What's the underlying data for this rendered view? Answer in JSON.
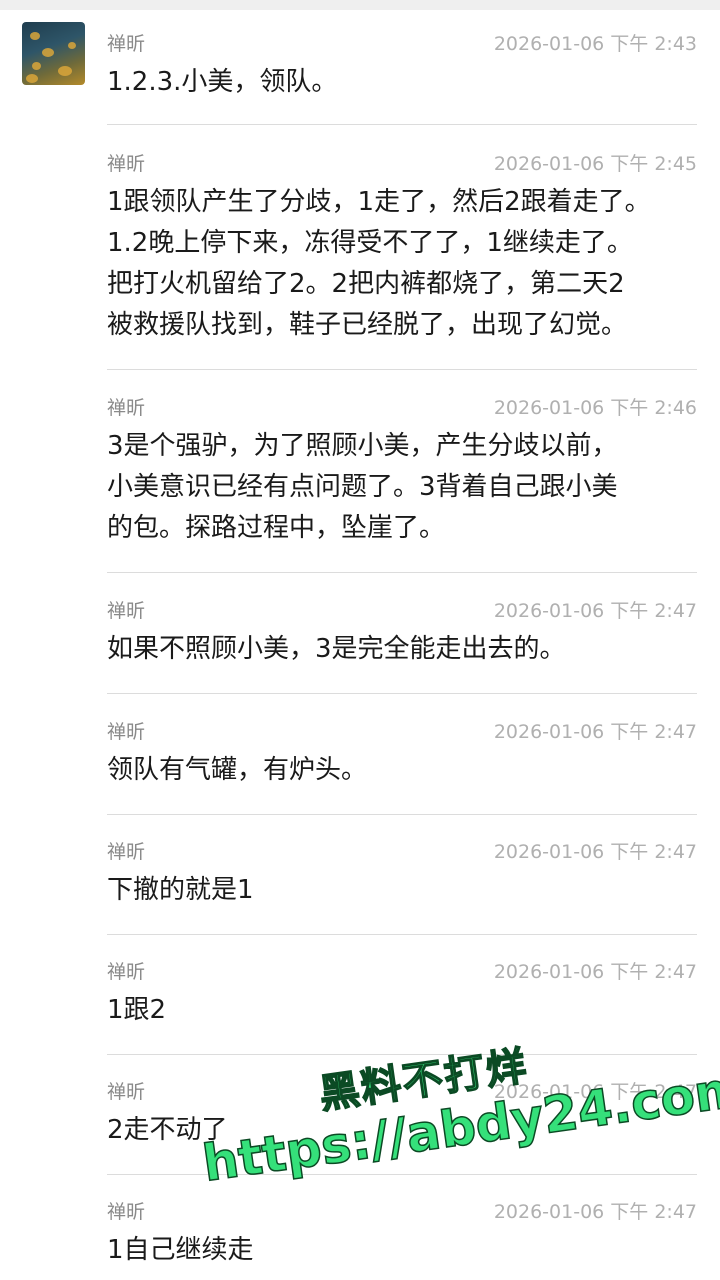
{
  "messages": [
    {
      "sender": "禅昕",
      "time": "2026-01-06 下午 2:43",
      "text": "1.2.3.小美，领队。"
    },
    {
      "sender": "禅昕",
      "time": "2026-01-06 下午 2:45",
      "text": "1跟领队产生了分歧，1走了，然后2跟着走了。\n1.2晚上停下来，冻得受不了了，1继续走了。\n把打火机留给了2。2把内裤都烧了，第二天2\n被救援队找到，鞋子已经脱了，出现了幻觉。"
    },
    {
      "sender": "禅昕",
      "time": "2026-01-06 下午 2:46",
      "text": "3是个强驴，为了照顾小美，产生分歧以前，\n小美意识已经有点问题了。3背着自己跟小美\n的包。探路过程中，坠崖了。"
    },
    {
      "sender": "禅昕",
      "time": "2026-01-06 下午 2:47",
      "text": "如果不照顾小美，3是完全能走出去的。"
    },
    {
      "sender": "禅昕",
      "time": "2026-01-06 下午 2:47",
      "text": "领队有气罐，有炉头。"
    },
    {
      "sender": "禅昕",
      "time": "2026-01-06 下午 2:47",
      "text": "下撤的就是1"
    },
    {
      "sender": "禅昕",
      "time": "2026-01-06 下午 2:47",
      "text": "1跟2"
    },
    {
      "sender": "禅昕",
      "time": "2026-01-06 下午 2:47",
      "text": "2走不动了"
    },
    {
      "sender": "禅昕",
      "time": "2026-01-06 下午 2:47",
      "text": "1自己继续走"
    }
  ],
  "watermark": {
    "line1": "黑料不打烊",
    "line2": "https://abdy24.com",
    "color": "#35e07a"
  }
}
